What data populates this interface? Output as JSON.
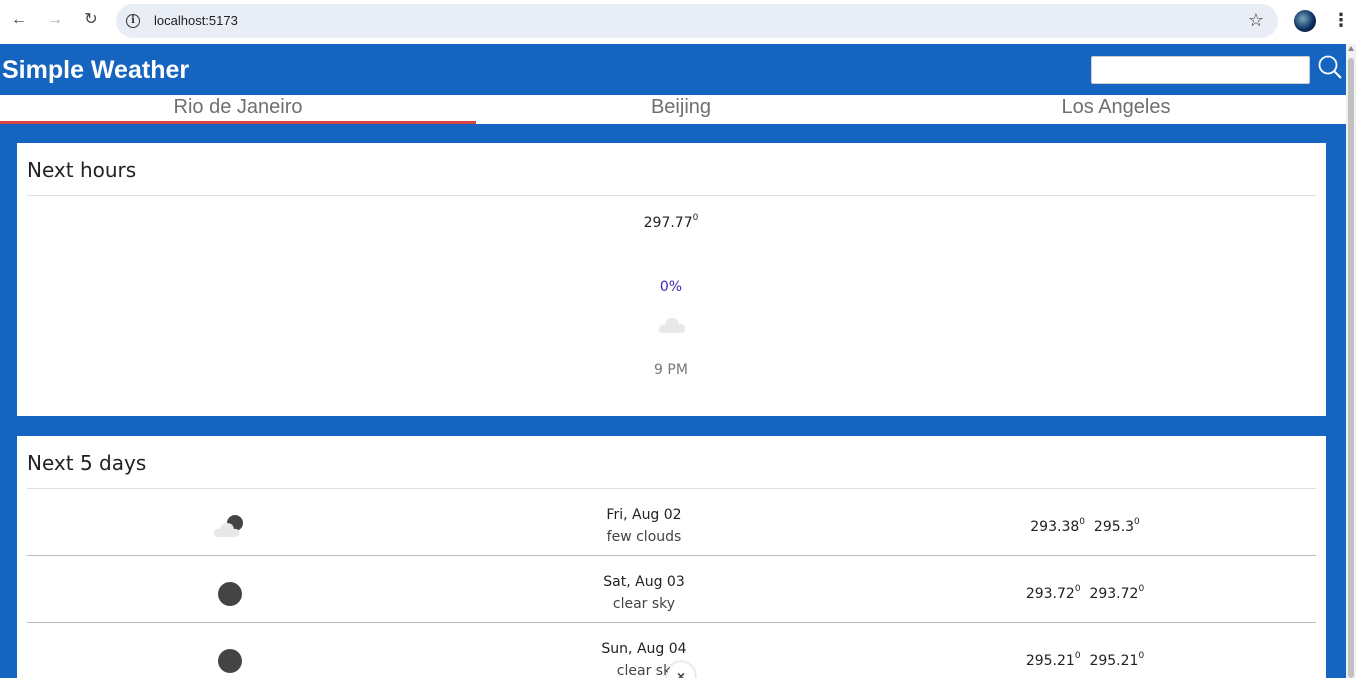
{
  "browser": {
    "url": "localhost:5173"
  },
  "app": {
    "brand": "Simple Weather",
    "search": {
      "value": "",
      "placeholder": ""
    }
  },
  "tabs": [
    {
      "label": "Rio de Janeiro",
      "active": true
    },
    {
      "label": "Beijing",
      "active": false
    },
    {
      "label": "Los Angeles",
      "active": false
    }
  ],
  "next_hours": {
    "title": "Next hours",
    "items": [
      {
        "temp": "297.77",
        "unit_sup": "0",
        "pop": "0%",
        "icon": "cloud-icon",
        "time": "9 PM"
      }
    ]
  },
  "next_days": {
    "title": "Next 5 days",
    "items": [
      {
        "icon": "few-clouds-night-icon",
        "date": "Fri, Aug 02",
        "desc": "few clouds",
        "min": "293.38",
        "max": "295.3",
        "sup": "0"
      },
      {
        "icon": "clear-sky-night-icon",
        "date": "Sat, Aug 03",
        "desc": "clear sky",
        "min": "293.72",
        "max": "293.72",
        "sup": "0"
      },
      {
        "icon": "clear-sky-night-icon",
        "date": "Sun, Aug 04",
        "desc": "clear sk",
        "min": "295.21",
        "max": "295.21",
        "sup": "0"
      }
    ]
  },
  "colors": {
    "brand_blue": "#1565c0",
    "active_tab_underline": "#d94343",
    "pop_text": "#3a2bb0"
  }
}
